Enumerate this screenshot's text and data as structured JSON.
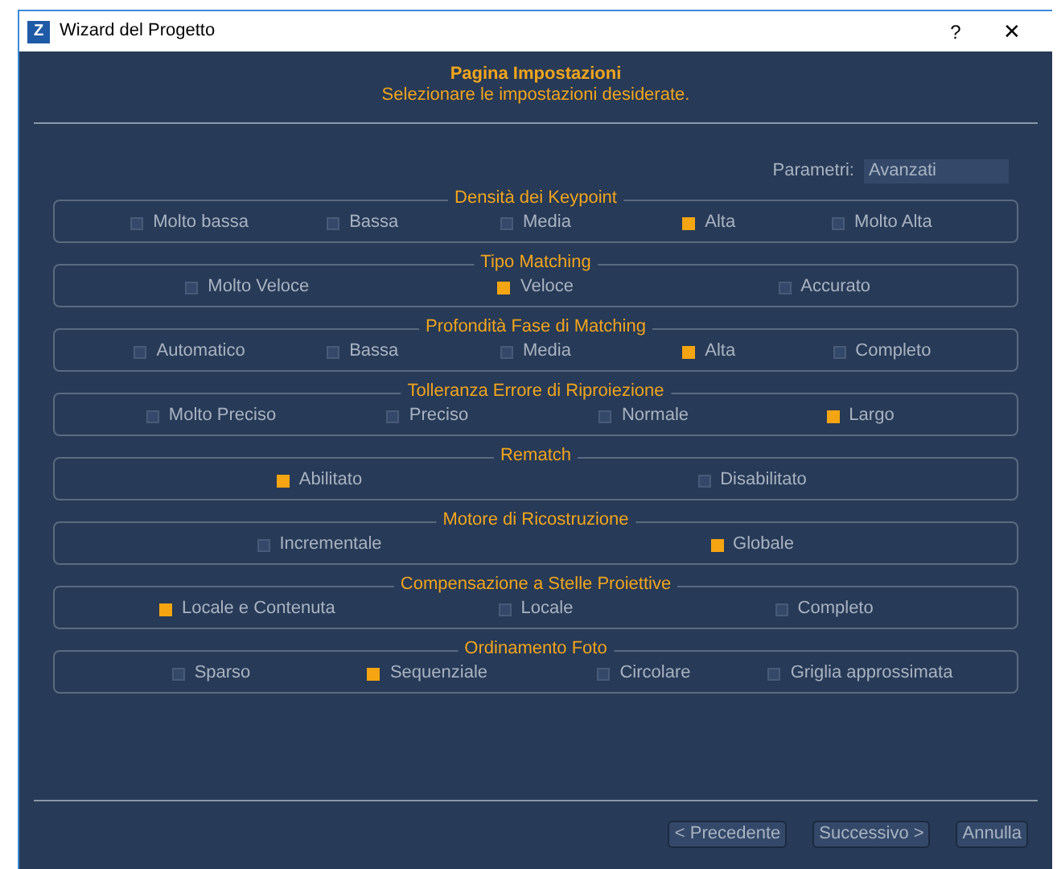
{
  "window": {
    "icon": "Z",
    "title": "Wizard del Progetto",
    "help": "?",
    "close": "✕"
  },
  "header": {
    "title": "Pagina Impostazioni",
    "subtitle": "Selezionare le impostazioni desiderate."
  },
  "parameters": {
    "label": "Parametri:",
    "value": "Avanzati"
  },
  "groups": [
    {
      "title": "Densità dei Keypoint",
      "options": [
        {
          "label": "Molto bassa",
          "selected": false
        },
        {
          "label": "Bassa",
          "selected": false
        },
        {
          "label": "Media",
          "selected": false
        },
        {
          "label": "Alta",
          "selected": true
        },
        {
          "label": "Molto Alta",
          "selected": false
        }
      ]
    },
    {
      "title": "Tipo Matching",
      "options": [
        {
          "label": "Molto Veloce",
          "selected": false
        },
        {
          "label": "Veloce",
          "selected": true
        },
        {
          "label": "Accurato",
          "selected": false
        }
      ]
    },
    {
      "title": "Profondità Fase di Matching",
      "options": [
        {
          "label": "Automatico",
          "selected": false
        },
        {
          "label": "Bassa",
          "selected": false
        },
        {
          "label": "Media",
          "selected": false
        },
        {
          "label": "Alta",
          "selected": true
        },
        {
          "label": "Completo",
          "selected": false
        }
      ]
    },
    {
      "title": "Tolleranza Errore di Riproiezione",
      "options": [
        {
          "label": "Molto Preciso",
          "selected": false
        },
        {
          "label": "Preciso",
          "selected": false
        },
        {
          "label": "Normale",
          "selected": false
        },
        {
          "label": "Largo",
          "selected": true
        }
      ]
    },
    {
      "title": "Rematch",
      "options": [
        {
          "label": "Abilitato",
          "selected": true
        },
        {
          "label": "Disabilitato",
          "selected": false
        }
      ]
    },
    {
      "title": "Motore di Ricostruzione",
      "options": [
        {
          "label": "Incrementale",
          "selected": false
        },
        {
          "label": "Globale",
          "selected": true
        }
      ]
    },
    {
      "title": "Compensazione a Stelle Proiettive",
      "options": [
        {
          "label": "Locale e Contenuta",
          "selected": true
        },
        {
          "label": "Locale",
          "selected": false
        },
        {
          "label": "Completo",
          "selected": false
        }
      ]
    },
    {
      "title": "Ordinamento Foto",
      "options": [
        {
          "label": "Sparso",
          "selected": false
        },
        {
          "label": "Sequenziale",
          "selected": true
        },
        {
          "label": "Circolare",
          "selected": false
        },
        {
          "label": "Griglia approssimata",
          "selected": false
        }
      ]
    }
  ],
  "buttons": [
    {
      "label": "< Precedente"
    },
    {
      "label": "Successivo >"
    },
    {
      "label": "Annulla"
    }
  ]
}
